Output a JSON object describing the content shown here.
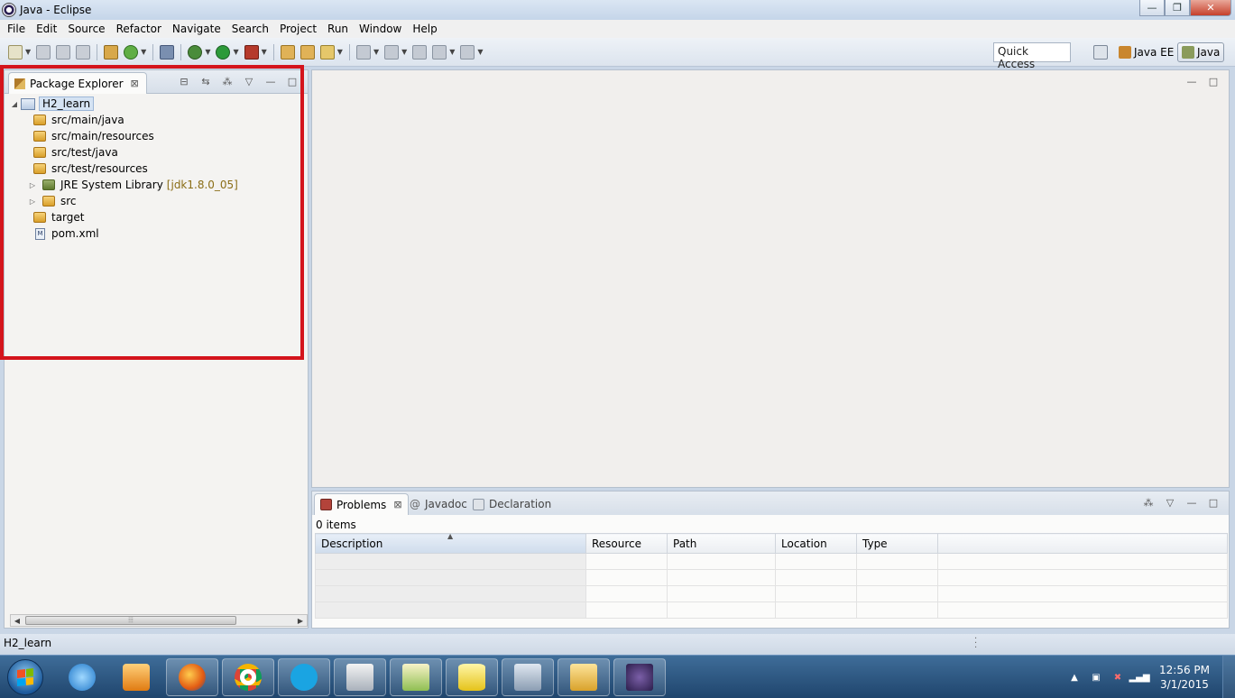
{
  "window": {
    "title": "Java - Eclipse",
    "minimize": "—",
    "restore": "❐",
    "close": "✕"
  },
  "menu": [
    "File",
    "Edit",
    "Source",
    "Refactor",
    "Navigate",
    "Search",
    "Project",
    "Run",
    "Window",
    "Help"
  ],
  "toolbar": {
    "quick_access": "Quick Access",
    "perspectives": [
      {
        "label": "Java EE",
        "active": false
      },
      {
        "label": "Java",
        "active": true
      }
    ]
  },
  "package_explorer": {
    "tab_label": "Package Explorer",
    "project": "H2_learn",
    "items": [
      {
        "label": "src/main/java",
        "type": "source-folder",
        "expandable": false
      },
      {
        "label": "src/main/resources",
        "type": "source-folder",
        "expandable": false
      },
      {
        "label": "src/test/java",
        "type": "source-folder",
        "expandable": false
      },
      {
        "label": "src/test/resources",
        "type": "source-folder",
        "expandable": false
      },
      {
        "label": "JRE System Library",
        "version": "[jdk1.8.0_05]",
        "type": "library",
        "expandable": true
      },
      {
        "label": "src",
        "type": "folder",
        "expandable": true
      },
      {
        "label": "target",
        "type": "folder",
        "expandable": false
      },
      {
        "label": "pom.xml",
        "type": "xml-file",
        "expandable": false
      }
    ]
  },
  "bottom_panel": {
    "tabs": [
      {
        "label": "Problems",
        "active": true
      },
      {
        "label": "Javadoc",
        "active": false
      },
      {
        "label": "Declaration",
        "active": false
      }
    ],
    "items_count": "0 items",
    "columns": [
      "Description",
      "Resource",
      "Path",
      "Location",
      "Type"
    ]
  },
  "status_bar": {
    "text": "H2_learn"
  },
  "taskbar": {
    "clock_time": "12:56 PM",
    "clock_date": "3/1/2015",
    "apps": [
      "internet-explorer",
      "media-player",
      "firefox",
      "chrome",
      "skype",
      "file-manager",
      "notepad",
      "database",
      "calculator",
      "explorer",
      "java-ee-ide"
    ]
  },
  "colors": {
    "highlight": "#d4141c",
    "taskbar": "#2b5785"
  }
}
